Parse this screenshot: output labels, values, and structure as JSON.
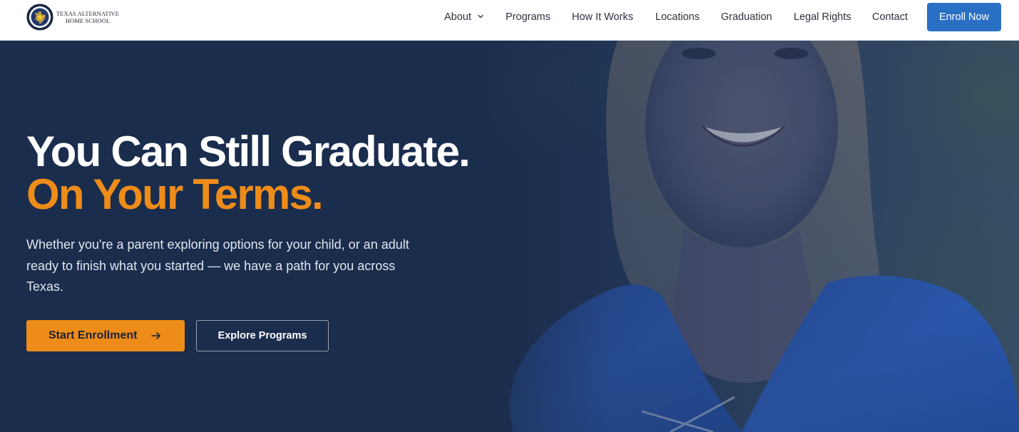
{
  "brand": {
    "name_line1": "TEXAS ALTERNATIVE",
    "name_line2": "HOME SCHOOL",
    "seal_icon": "texas-star-seal-icon",
    "colors": {
      "accent": "#ee8c1a",
      "primary": "#2970c4",
      "hero_bg": "#1c2e4d"
    }
  },
  "nav": {
    "items": [
      {
        "label": "About",
        "has_dropdown": true
      },
      {
        "label": "Programs"
      },
      {
        "label": "How It Works"
      },
      {
        "label": "Locations"
      },
      {
        "label": "Graduation"
      },
      {
        "label": "Legal Rights"
      },
      {
        "label": "Contact"
      }
    ],
    "cta_label": "Enroll Now"
  },
  "hero": {
    "headline_line1": "You Can Still Graduate.",
    "headline_line2": "On Your Terms.",
    "subtext": "Whether you're a parent exploring options for your child, or an adult ready to finish what you started — we have a path for you across Texas.",
    "primary_button": "Start Enrollment",
    "primary_button_icon": "arrow-right-icon",
    "secondary_button": "Explore Programs",
    "background_image": "graduate-in-blue-gown-photo"
  }
}
